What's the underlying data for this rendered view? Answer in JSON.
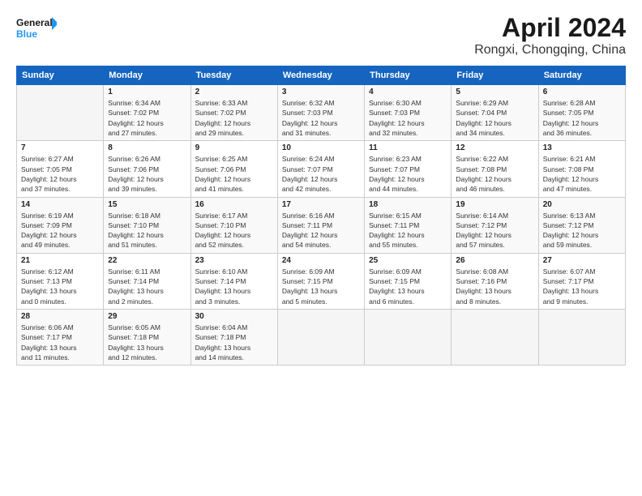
{
  "logo": {
    "line1": "General",
    "line2": "Blue"
  },
  "title": "April 2024",
  "subtitle": "Rongxi, Chongqing, China",
  "days": [
    "Sunday",
    "Monday",
    "Tuesday",
    "Wednesday",
    "Thursday",
    "Friday",
    "Saturday"
  ],
  "weeks": [
    [
      {
        "date": "",
        "info": ""
      },
      {
        "date": "1",
        "info": "Sunrise: 6:34 AM\nSunset: 7:02 PM\nDaylight: 12 hours\nand 27 minutes."
      },
      {
        "date": "2",
        "info": "Sunrise: 6:33 AM\nSunset: 7:02 PM\nDaylight: 12 hours\nand 29 minutes."
      },
      {
        "date": "3",
        "info": "Sunrise: 6:32 AM\nSunset: 7:03 PM\nDaylight: 12 hours\nand 31 minutes."
      },
      {
        "date": "4",
        "info": "Sunrise: 6:30 AM\nSunset: 7:03 PM\nDaylight: 12 hours\nand 32 minutes."
      },
      {
        "date": "5",
        "info": "Sunrise: 6:29 AM\nSunset: 7:04 PM\nDaylight: 12 hours\nand 34 minutes."
      },
      {
        "date": "6",
        "info": "Sunrise: 6:28 AM\nSunset: 7:05 PM\nDaylight: 12 hours\nand 36 minutes."
      }
    ],
    [
      {
        "date": "7",
        "info": "Sunrise: 6:27 AM\nSunset: 7:05 PM\nDaylight: 12 hours\nand 37 minutes."
      },
      {
        "date": "8",
        "info": "Sunrise: 6:26 AM\nSunset: 7:06 PM\nDaylight: 12 hours\nand 39 minutes."
      },
      {
        "date": "9",
        "info": "Sunrise: 6:25 AM\nSunset: 7:06 PM\nDaylight: 12 hours\nand 41 minutes."
      },
      {
        "date": "10",
        "info": "Sunrise: 6:24 AM\nSunset: 7:07 PM\nDaylight: 12 hours\nand 42 minutes."
      },
      {
        "date": "11",
        "info": "Sunrise: 6:23 AM\nSunset: 7:07 PM\nDaylight: 12 hours\nand 44 minutes."
      },
      {
        "date": "12",
        "info": "Sunrise: 6:22 AM\nSunset: 7:08 PM\nDaylight: 12 hours\nand 46 minutes."
      },
      {
        "date": "13",
        "info": "Sunrise: 6:21 AM\nSunset: 7:08 PM\nDaylight: 12 hours\nand 47 minutes."
      }
    ],
    [
      {
        "date": "14",
        "info": "Sunrise: 6:19 AM\nSunset: 7:09 PM\nDaylight: 12 hours\nand 49 minutes."
      },
      {
        "date": "15",
        "info": "Sunrise: 6:18 AM\nSunset: 7:10 PM\nDaylight: 12 hours\nand 51 minutes."
      },
      {
        "date": "16",
        "info": "Sunrise: 6:17 AM\nSunset: 7:10 PM\nDaylight: 12 hours\nand 52 minutes."
      },
      {
        "date": "17",
        "info": "Sunrise: 6:16 AM\nSunset: 7:11 PM\nDaylight: 12 hours\nand 54 minutes."
      },
      {
        "date": "18",
        "info": "Sunrise: 6:15 AM\nSunset: 7:11 PM\nDaylight: 12 hours\nand 55 minutes."
      },
      {
        "date": "19",
        "info": "Sunrise: 6:14 AM\nSunset: 7:12 PM\nDaylight: 12 hours\nand 57 minutes."
      },
      {
        "date": "20",
        "info": "Sunrise: 6:13 AM\nSunset: 7:12 PM\nDaylight: 12 hours\nand 59 minutes."
      }
    ],
    [
      {
        "date": "21",
        "info": "Sunrise: 6:12 AM\nSunset: 7:13 PM\nDaylight: 13 hours\nand 0 minutes."
      },
      {
        "date": "22",
        "info": "Sunrise: 6:11 AM\nSunset: 7:14 PM\nDaylight: 13 hours\nand 2 minutes."
      },
      {
        "date": "23",
        "info": "Sunrise: 6:10 AM\nSunset: 7:14 PM\nDaylight: 13 hours\nand 3 minutes."
      },
      {
        "date": "24",
        "info": "Sunrise: 6:09 AM\nSunset: 7:15 PM\nDaylight: 13 hours\nand 5 minutes."
      },
      {
        "date": "25",
        "info": "Sunrise: 6:09 AM\nSunset: 7:15 PM\nDaylight: 13 hours\nand 6 minutes."
      },
      {
        "date": "26",
        "info": "Sunrise: 6:08 AM\nSunset: 7:16 PM\nDaylight: 13 hours\nand 8 minutes."
      },
      {
        "date": "27",
        "info": "Sunrise: 6:07 AM\nSunset: 7:17 PM\nDaylight: 13 hours\nand 9 minutes."
      }
    ],
    [
      {
        "date": "28",
        "info": "Sunrise: 6:06 AM\nSunset: 7:17 PM\nDaylight: 13 hours\nand 11 minutes."
      },
      {
        "date": "29",
        "info": "Sunrise: 6:05 AM\nSunset: 7:18 PM\nDaylight: 13 hours\nand 12 minutes."
      },
      {
        "date": "30",
        "info": "Sunrise: 6:04 AM\nSunset: 7:18 PM\nDaylight: 13 hours\nand 14 minutes."
      },
      {
        "date": "",
        "info": ""
      },
      {
        "date": "",
        "info": ""
      },
      {
        "date": "",
        "info": ""
      },
      {
        "date": "",
        "info": ""
      }
    ]
  ]
}
